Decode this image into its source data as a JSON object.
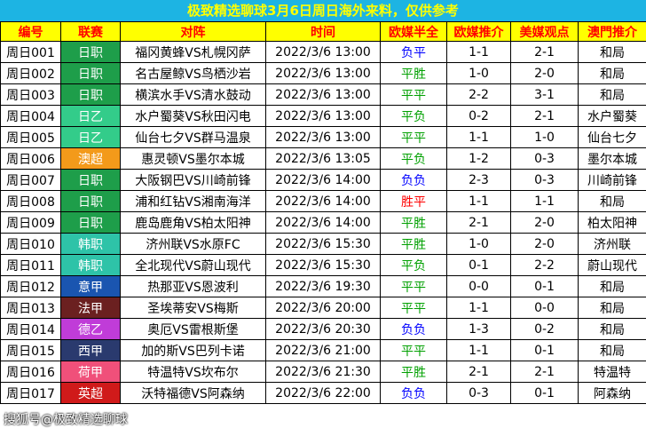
{
  "banner": "极致精选聊球3月6日周日海外来料，仅供参考",
  "headers": [
    "编号",
    "联赛",
    "对阵",
    "时间",
    "欧媒半全",
    "欧媒推介",
    "美媒观点",
    "澳門推介"
  ],
  "rows": [
    {
      "id": "周日001",
      "league": "日职",
      "league_color": "#1e9e4a",
      "match": "福冈黄蜂VS札幌冈萨",
      "time": "2022/3/6 13:00",
      "halffull": "负平",
      "hf_color": "#0000ff",
      "euro": "1-1",
      "us": "2-1",
      "macau": "和局"
    },
    {
      "id": "周日002",
      "league": "日职",
      "league_color": "#1e9e4a",
      "match": "名古屋鲸VS鸟栖沙岩",
      "time": "2022/3/6 13:00",
      "halffull": "平胜",
      "hf_color": "#00a000",
      "euro": "1-0",
      "us": "2-0",
      "macau": "和局"
    },
    {
      "id": "周日003",
      "league": "日职",
      "league_color": "#1e9e4a",
      "match": "横滨水手VS清水鼓动",
      "time": "2022/3/6 13:00",
      "halffull": "平平",
      "hf_color": "#00a000",
      "euro": "2-2",
      "us": "3-1",
      "macau": "和局"
    },
    {
      "id": "周日004",
      "league": "日乙",
      "league_color": "#33cc8a",
      "match": "水户蜀葵VS秋田闪电",
      "time": "2022/3/6 13:00",
      "halffull": "平负",
      "hf_color": "#00a000",
      "euro": "0-2",
      "us": "2-1",
      "macau": "水户蜀葵"
    },
    {
      "id": "周日005",
      "league": "日乙",
      "league_color": "#33cc8a",
      "match": "仙台七夕VS群马温泉",
      "time": "2022/3/6 13:00",
      "halffull": "平平",
      "hf_color": "#00a000",
      "euro": "1-1",
      "us": "1-0",
      "macau": "仙台七夕"
    },
    {
      "id": "周日006",
      "league": "澳超",
      "league_color": "#f39a1a",
      "match": "惠灵顿VS墨尔本城",
      "time": "2022/3/6 13:05",
      "halffull": "平负",
      "hf_color": "#00a000",
      "euro": "1-2",
      "us": "0-3",
      "macau": "墨尔本城"
    },
    {
      "id": "周日007",
      "league": "日职",
      "league_color": "#1e9e4a",
      "match": "大阪钢巴VS川崎前锋",
      "time": "2022/3/6 14:00",
      "halffull": "负负",
      "hf_color": "#0000ff",
      "euro": "2-3",
      "us": "0-3",
      "macau": "川崎前锋"
    },
    {
      "id": "周日008",
      "league": "日职",
      "league_color": "#1e9e4a",
      "match": "浦和红钻VS湘南海洋",
      "time": "2022/3/6 14:00",
      "halffull": "胜平",
      "hf_color": "#ff0000",
      "euro": "1-1",
      "us": "1-1",
      "macau": "和局"
    },
    {
      "id": "周日009",
      "league": "日职",
      "league_color": "#1e9e4a",
      "match": "鹿岛鹿角VS柏太阳神",
      "time": "2022/3/6 14:00",
      "halffull": "平胜",
      "hf_color": "#00a000",
      "euro": "2-1",
      "us": "2-0",
      "macau": "柏太阳神"
    },
    {
      "id": "周日010",
      "league": "韩职",
      "league_color": "#2ec3a8",
      "match": "济州联VS水原FC",
      "time": "2022/3/6 15:30",
      "halffull": "平胜",
      "hf_color": "#00a000",
      "euro": "1-0",
      "us": "2-0",
      "macau": "济州联"
    },
    {
      "id": "周日011",
      "league": "韩职",
      "league_color": "#2ec3a8",
      "match": "全北现代VS蔚山现代",
      "time": "2022/3/6 15:30",
      "halffull": "平负",
      "hf_color": "#00a000",
      "euro": "0-1",
      "us": "2-2",
      "macau": "蔚山现代"
    },
    {
      "id": "周日012",
      "league": "意甲",
      "league_color": "#1a55b0",
      "match": "热那亚VS恩波利",
      "time": "2022/3/6 19:30",
      "halffull": "平平",
      "hf_color": "#00a000",
      "euro": "0-0",
      "us": "0-1",
      "macau": "和局"
    },
    {
      "id": "周日013",
      "league": "法甲",
      "league_color": "#6b2020",
      "match": "圣埃蒂安VS梅斯",
      "time": "2022/3/6 20:00",
      "halffull": "平平",
      "hf_color": "#00a000",
      "euro": "1-1",
      "us": "0-0",
      "macau": "和局"
    },
    {
      "id": "周日014",
      "league": "德乙",
      "league_color": "#c03cd8",
      "match": "奥厄VS雷根斯堡",
      "time": "2022/3/6 20:30",
      "halffull": "负负",
      "hf_color": "#0000ff",
      "euro": "1-3",
      "us": "0-2",
      "macau": "和局"
    },
    {
      "id": "周日015",
      "league": "西甲",
      "league_color": "#2a3a6e",
      "match": "加的斯VS巴列卡诺",
      "time": "2022/3/6 21:00",
      "halffull": "平平",
      "hf_color": "#00a000",
      "euro": "1-1",
      "us": "0-1",
      "macau": "和局"
    },
    {
      "id": "周日016",
      "league": "荷甲",
      "league_color": "#f0507a",
      "match": "特温特VS坎布尔",
      "time": "2022/3/6 21:30",
      "halffull": "平胜",
      "hf_color": "#00a000",
      "euro": "2-1",
      "us": "2-1",
      "macau": "特温特"
    },
    {
      "id": "周日017",
      "league": "英超",
      "league_color": "#d01a1a",
      "match": "沃特福德VS阿森纳",
      "time": "2022/3/6 22:00",
      "halffull": "负负",
      "hf_color": "#0000ff",
      "euro": "0-3",
      "us": "0-1",
      "macau": "阿森纳"
    }
  ],
  "watermark": "搜狐号@极致精选聊球"
}
